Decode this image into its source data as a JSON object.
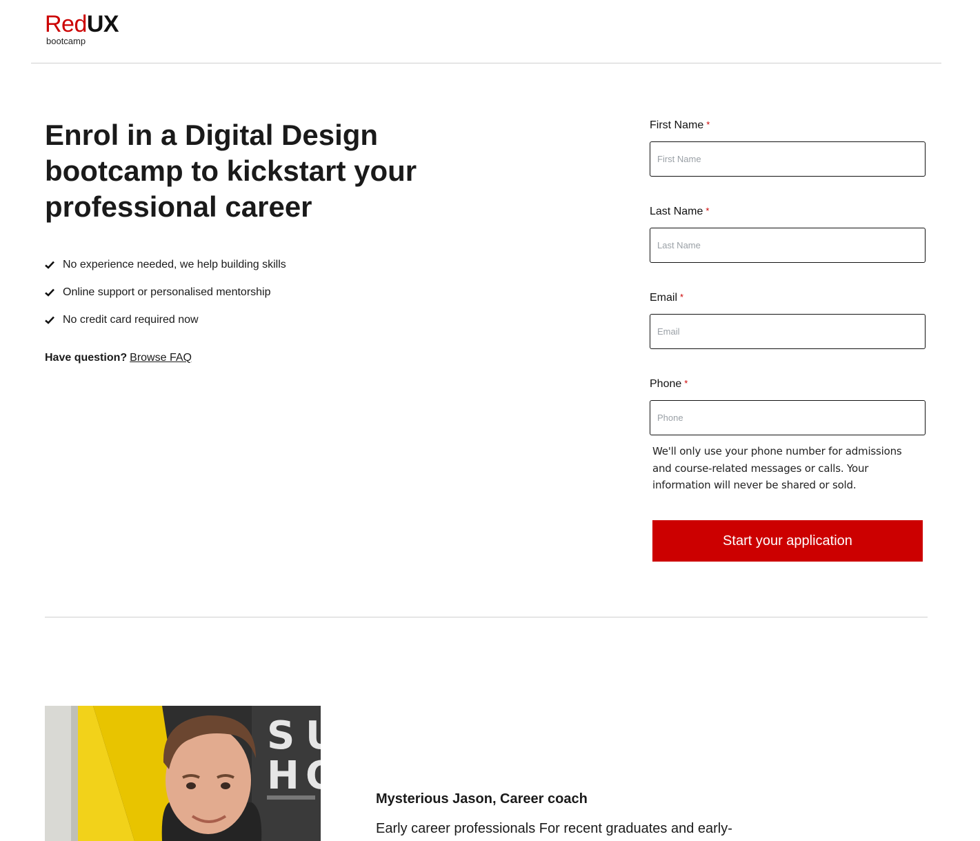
{
  "brand": {
    "name_red": "Red",
    "name_dark": "UX",
    "tagline": "bootcamp",
    "accent_color": "#cc0000"
  },
  "hero": {
    "title": "Enrol in a Digital Design bootcamp to kickstart your professional career",
    "benefits": [
      "No experience needed, we help building skills",
      "Online support or personalised mentorship",
      "No credit card required now"
    ],
    "question_text": "Have question?",
    "faq_link": "Browse FAQ"
  },
  "form": {
    "required_marker": "*",
    "fields": [
      {
        "label": "First Name",
        "placeholder": "First Name",
        "value": ""
      },
      {
        "label": "Last Name",
        "placeholder": "Last Name",
        "value": ""
      },
      {
        "label": "Email",
        "placeholder": "Email",
        "value": ""
      },
      {
        "label": "Phone",
        "placeholder": "Phone",
        "value": ""
      }
    ],
    "privacy_note": "We'll only use your phone number for admissions and course-related messages or calls. Your information will never be shared or sold.",
    "submit_label": "Start your application"
  },
  "testimonial": {
    "coach": "Mysterious Jason, Career coach",
    "quote_start": "Early career professionals For recent graduates and early-"
  },
  "icons": {
    "benefit_marker": "check-icon"
  }
}
